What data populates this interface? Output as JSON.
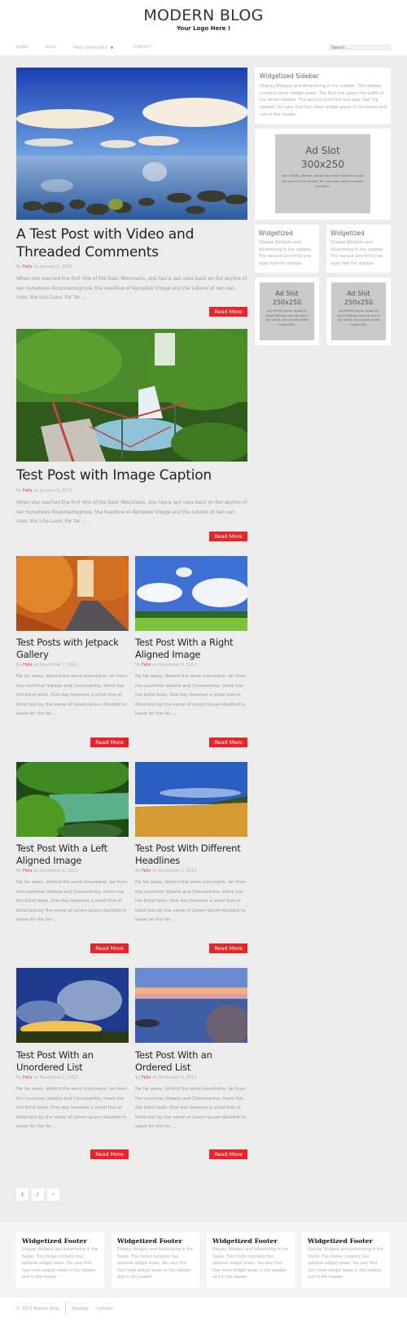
{
  "header": {
    "title": "MODERN BLOG",
    "tagline": "Your Logo Here !"
  },
  "nav": {
    "items": [
      {
        "label": "HOME"
      },
      {
        "label": "BLOG"
      },
      {
        "label": "PAGE TEMPLATES",
        "has_dropdown": true,
        "caret": "▼"
      },
      {
        "label": "CONTACT"
      }
    ],
    "search_placeholder": "Search ..."
  },
  "colors": {
    "accent": "#e8232a",
    "background": "#ececec",
    "widget_bg": "#ffffff",
    "ad_bg": "#c9c9c9"
  },
  "posts": [
    {
      "title": "A Test Post with Video and Threaded Comments",
      "by": "By",
      "author": "Felix",
      "date": "on January 6, 2013",
      "excerpt": "When she reached the first hills of the Italic Mountains, she had a last view back on the skyline of her hometown Bookmarksgrove, the headline of Alphabet Village and the subline of her own road, the Line Lane. Far far ...",
      "read_more": "Read More",
      "image": "lake-clouds-rocks"
    },
    {
      "title": "Test Post with Image Caption",
      "by": "By",
      "author": "Felix",
      "date": "on January 5, 2013",
      "excerpt": "When she reached the first hills of the Italic Mountains, she had a last view back on the skyline of her hometown Bookmarksgrove, the headline of Alphabet Village and the subline of her own road, the Line Lane. Far far ...",
      "read_more": "Read More",
      "image": "forest-waterfall-bridge"
    },
    {
      "title": "Test Posts with Jetpack Gallery",
      "by": "By",
      "author": "Felix",
      "date": "on November 7, 2012",
      "excerpt": "Far far away, behind the word mountains, far from the countries Vokalia and Consonantia, there live the blind texts. One day however a small line of blind text by the name of Lorem Ipsum decided to leave for the far ...",
      "read_more": "Read More",
      "image": "autumn-road"
    },
    {
      "title": "Test Post With a Right Aligned Image",
      "by": "By",
      "author": "Felix",
      "date": "on November 2, 2012",
      "excerpt": "Far far away, behind the word mountains, far from the countries Vokalia and Consonantia, there live the blind texts. One day however a small line of blind text by the name of Lorem Ipsum decided to leave for the far ...",
      "read_more": "Read More",
      "image": "green-meadow-sky"
    },
    {
      "title": "Test Post With a Left Aligned Image",
      "by": "By",
      "author": "Felix",
      "date": "on November 2, 2012",
      "excerpt": "Far far away, behind the word mountains, far from the countries Vokalia and Consonantia, there live the blind texts. One day however a small line of blind text by the name of Lorem Ipsum decided to leave for the far ...",
      "read_more": "Read More",
      "image": "green-river"
    },
    {
      "title": "Test Post With Different Headlines",
      "by": "By",
      "author": "Felix",
      "date": "on November 2, 2012",
      "excerpt": "Far far away, behind the word mountains, far from the countries Vokalia and Consonantia, there live the blind texts. One day however a small line of blind text by the name of Lorem Ipsum decided to leave for the far ...",
      "read_more": "Read More",
      "image": "wheat-field"
    },
    {
      "title": "Test Post With an Unordered List",
      "by": "By",
      "author": "Felix",
      "date": "on November 2, 2012",
      "excerpt": "Far far away, behind the word mountains, far from the countries Vokalia and Consonantia, there live the blind texts. One day however a small line of blind text by the name of Lorem Ipsum decided to leave for the far ...",
      "read_more": "Read More",
      "image": "sunset-field"
    },
    {
      "title": "Test Post With an Ordered List",
      "by": "By",
      "author": "Felix",
      "date": "on November 2, 2012",
      "excerpt": "Far far away, behind the word mountains, far from the countries Vokalia and Consonantia, there live the blind texts. One day however a small line of blind text by the name of Lorem Ipsum decided to leave for the far ...",
      "read_more": "Read More",
      "image": "sunset-lake-rocks"
    }
  ],
  "sidebar": {
    "main_widget": {
      "title": "Widgetized Sidebar",
      "text": "Display Widgets and Advertising in the sidebar. This sidebar contains three widget areas. The first one spans the width of the whole sidebar. The second and third one span half the sidebar. You also find four more widget areas in the footer and one in the header."
    },
    "ad_large": {
      "title": "Ad Slot",
      "size": "300x250",
      "text": "Any XHTML, Iframe, JavaScript and/or AdSense code will work in this ad slot. You can even rotate multiple ad codes."
    },
    "half_widgets": [
      {
        "title": "Widgetized",
        "text": "Display Widgets and Advertising in the sidebar. The second and third one span half the sidebar."
      },
      {
        "title": "Widgetized",
        "text": "Display Widgets and Advertising in the sidebar. The second and third one span half the sidebar."
      }
    ],
    "ad_small": [
      {
        "title": "Ad Slot",
        "size": "250x250",
        "text": "Any XHTML, Iframe, JavaScript and/or AdSense code will work in this ad slot. You can even rotate multiple ads."
      },
      {
        "title": "Ad Slot",
        "size": "250x250",
        "text": "Any XHTML, Iframe, JavaScript and/or AdSense code will work in this ad slot. You can even rotate multiple ads."
      }
    ]
  },
  "pagination": {
    "pages": [
      "1",
      "2",
      "»"
    ],
    "current": "1"
  },
  "footer_widgets": [
    {
      "title": "Widgetized Footer",
      "text": "Display Widgets and Advertising in the footer. This footer contains four optional widget areas. You also find four more widget areas in the sidebar and in the header."
    },
    {
      "title": "Widgetized Footer",
      "text": "Display Widgets and Advertising in the footer. This footer contains four optional widget areas. You also find four more widget areas in the sidebar and in the header."
    },
    {
      "title": "Widgetized Footer",
      "text": "Display Widgets and Advertising in the footer. This footer contains four optional widget areas. You also find four more widget areas in the sidebar and in the header."
    },
    {
      "title": "Widgetized Footer",
      "text": "Display Widgets and Advertising in the footer. This footer contains four optional widget areas. You also find four more widget areas in the sidebar and in the header."
    }
  ],
  "bottom_bar": {
    "copyright": "© 2013 Modern Blog",
    "links": [
      "Sitemap",
      "Contact"
    ]
  }
}
